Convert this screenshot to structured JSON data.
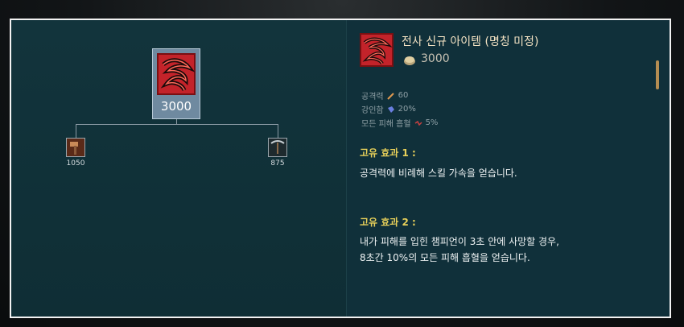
{
  "item": {
    "name": "전사 신규 아이템 (명칭 미정)",
    "cost": "3000",
    "main_price": "3000"
  },
  "components": [
    {
      "icon": "hammer-icon",
      "price": "1050"
    },
    {
      "icon": "pickaxe-icon",
      "price": "875"
    }
  ],
  "stats": [
    {
      "label": "공격력",
      "icon": "sword-stat-icon",
      "value": "60"
    },
    {
      "label": "강인함",
      "icon": "tenacity-icon",
      "value": "20%"
    },
    {
      "label": "모든 피해 흡혈",
      "icon": "lifesteal-icon",
      "value": "5%"
    }
  ],
  "passives": [
    {
      "title": "고유 효과 1 :",
      "lines": [
        "공격력에 비례해 스킬 가속을 얻습니다."
      ]
    },
    {
      "title": "고유 효과 2 :",
      "lines": [
        "내가 피해를 입힌 챔피언이 3초 안에 사망할 경우,",
        "8초간 10%의 모든 피해 흡혈을 얻습니다."
      ]
    }
  ],
  "colors": {
    "panel_bg": "#12323a",
    "title": "#f3e2c3",
    "passive_title": "#e7d05a",
    "accent_gold": "#b58d52"
  }
}
